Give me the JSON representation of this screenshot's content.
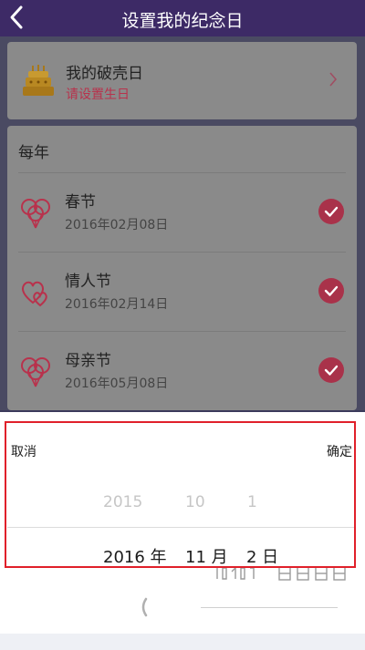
{
  "header": {
    "title": "设置我的纪念日"
  },
  "birthday": {
    "title": "我的破壳日",
    "subtitle": "请设置生日"
  },
  "yearly": {
    "section_label": "每年",
    "items": [
      {
        "name": "春节",
        "date": "2016年02月08日"
      },
      {
        "name": "情人节",
        "date": "2016年02月14日"
      },
      {
        "name": "母亲节",
        "date": "2016年05月08日"
      }
    ]
  },
  "picker": {
    "cancel_label": "取消",
    "confirm_label": "确定",
    "previous_row": {
      "year": "2015",
      "month": "10",
      "day": "1"
    },
    "selected_row": {
      "year": "2016 年",
      "month": "11 月",
      "day": "2 日"
    }
  },
  "colors": {
    "header_bg": "#3d2a66",
    "accent_red": "#b8324c",
    "highlight_frame": "#e0202a"
  },
  "icons": [
    "back-icon",
    "cake-icon",
    "chevron-right-icon",
    "balloons-icon",
    "hearts-icon",
    "check-circle-icon"
  ]
}
